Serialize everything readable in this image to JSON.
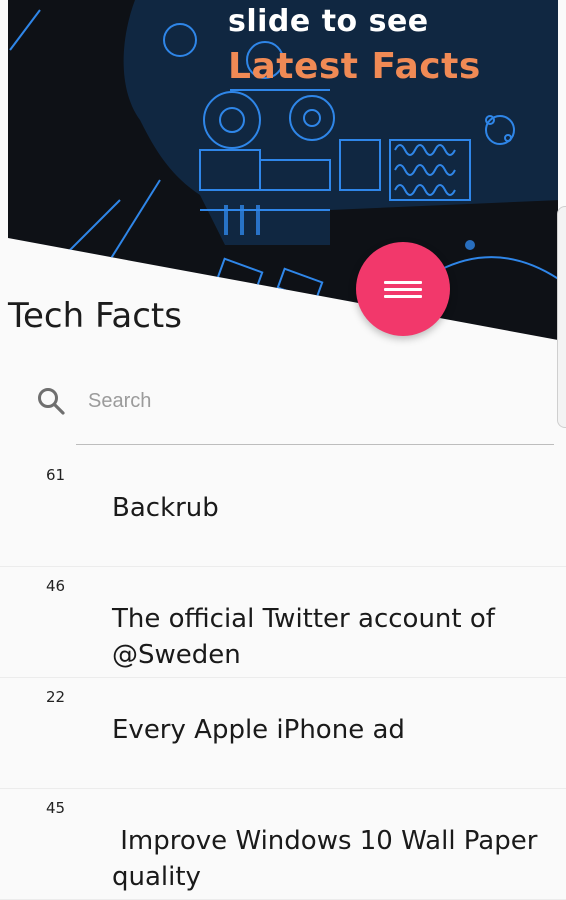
{
  "banner": {
    "line1": "slide to see",
    "line2": "Latest Facts",
    "line2_color": "#f08a55",
    "background_color": "#0e1116",
    "art_color": "#2f86e8"
  },
  "menu_fab": {
    "icon": "hamburger-menu-icon",
    "color": "#f2386b"
  },
  "header": {
    "title": "Tech Facts"
  },
  "search": {
    "placeholder": "Search",
    "value": "",
    "icon": "search-icon"
  },
  "facts": [
    {
      "count": "61",
      "title": "Backrub"
    },
    {
      "count": "46",
      "title": "The official Twitter account of @Sweden"
    },
    {
      "count": "22",
      "title": "Every Apple iPhone ad"
    },
    {
      "count": "45",
      "title": " Improve Windows 10 Wall Paper quality"
    }
  ]
}
